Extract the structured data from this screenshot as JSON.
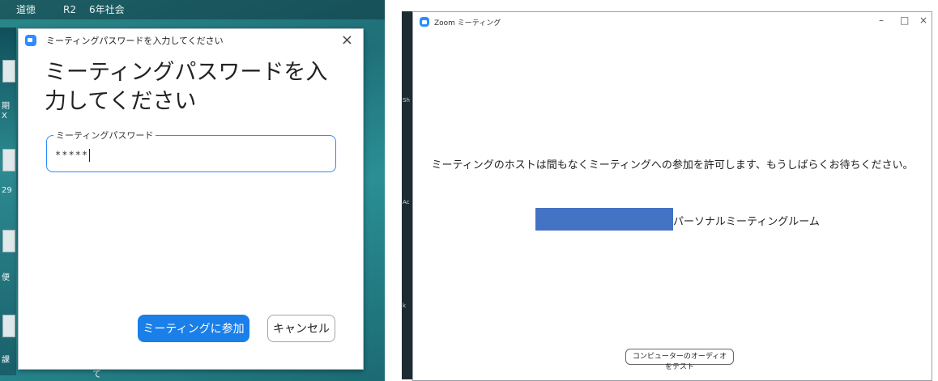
{
  "desktop": {
    "taskbar_items": [
      "道徳",
      "R2",
      "6年社会"
    ],
    "side_labels": [
      "期",
      "X",
      "29",
      "便",
      "課"
    ],
    "bottom_label": "て"
  },
  "password_dialog": {
    "title": "ミーティングパスワードを入力してください",
    "close_icon": "×",
    "heading": "ミーティングパスワードを入力してください",
    "field_label": "ミーティングパスワード",
    "field_value": "*****",
    "join_button": "ミーティングに参加",
    "cancel_button": "キャンセル"
  },
  "zoom_window": {
    "title": "Zoom ミーティング",
    "minimize": "–",
    "maximize": "□",
    "close": "×",
    "edge_labels": [
      "Sh",
      "Ac",
      "k"
    ],
    "message": "ミーティングのホストは間もなくミーティングへの参加を許可します、もうしばらくお待ちください。",
    "room_label": "パーソナルミーティングルーム",
    "test_audio_button": "コンピューターのオーディオをテスト"
  },
  "colors": {
    "zoom_blue": "#2d8cff",
    "join_button": "#1a7fe8",
    "redaction": "#4472c4",
    "desktop_teal": "#2b8a8a"
  }
}
